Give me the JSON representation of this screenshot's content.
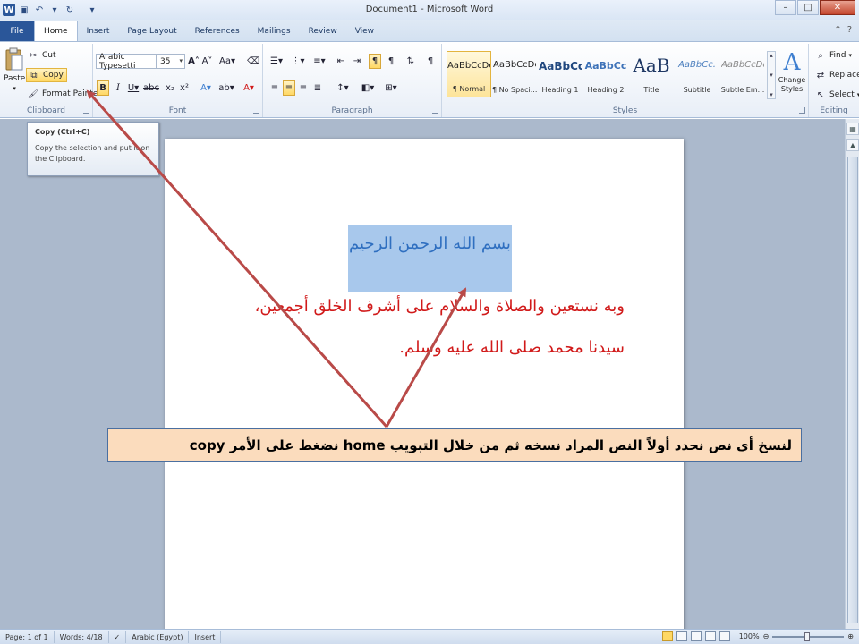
{
  "window": {
    "title": "Document1 - Microsoft Word",
    "logo": "W",
    "controls": {
      "minimize": "–",
      "maximize": "□",
      "close": "✕"
    }
  },
  "tabs": [
    {
      "label": "File"
    },
    {
      "label": "Home"
    },
    {
      "label": "Insert"
    },
    {
      "label": "Page Layout"
    },
    {
      "label": "References"
    },
    {
      "label": "Mailings"
    },
    {
      "label": "Review"
    },
    {
      "label": "View"
    }
  ],
  "active_tab": "Home",
  "ribbon": {
    "clipboard": {
      "group_label": "Clipboard",
      "paste_label": "Paste",
      "cut_label": "Cut",
      "copy_label": "Copy",
      "format_painter_label": "Format Painter"
    },
    "font": {
      "group_label": "Font",
      "font_name": "Arabic Typesetti",
      "font_size": "35"
    },
    "paragraph": {
      "group_label": "Paragraph"
    },
    "styles": {
      "group_label": "Styles",
      "items": [
        {
          "preview": "AaBbCcDc",
          "name": "¶ Normal"
        },
        {
          "preview": "AaBbCcDc",
          "name": "¶ No Spaci..."
        },
        {
          "preview": "AaBbCc",
          "name": "Heading 1"
        },
        {
          "preview": "AaBbCc",
          "name": "Heading 2"
        },
        {
          "preview": "AaB",
          "name": "Title"
        },
        {
          "preview": "AaBbCc.",
          "name": "Subtitle"
        },
        {
          "preview": "AaBbCcDc",
          "name": "Subtle Em..."
        }
      ],
      "change_styles_label": "Change Styles"
    },
    "editing": {
      "group_label": "Editing",
      "find_label": "Find",
      "replace_label": "Replace",
      "select_label": "Select"
    }
  },
  "tooltip": {
    "title": "Copy (Ctrl+C)",
    "body": "Copy the selection and put it on the Clipboard."
  },
  "document": {
    "line1": "بسم الله الرحمن الرحيم",
    "line2": "وبه نستعين والصلاة والسلام على أشرف الخلق أجمعين،",
    "line3": "سيدنا محمد صلى الله عليه وسلم."
  },
  "annotation": {
    "text": "لنسخ أى نص نحدد أولاً النص المراد نسخه ثم من خلال التبويب  home  نضغط على الأمر  copy"
  },
  "statusbar": {
    "page": "Page: 1 of 1",
    "words": "Words: 4/18",
    "language": "Arabic (Egypt)",
    "mode": "Insert",
    "zoom": "100%"
  },
  "colors": {
    "selection": "#a8c8ec",
    "heading_text": "#2f6fc0",
    "body_text": "#d11a1a",
    "annotation_bg": "#fbdcbd",
    "arrow": "#b94a48"
  }
}
